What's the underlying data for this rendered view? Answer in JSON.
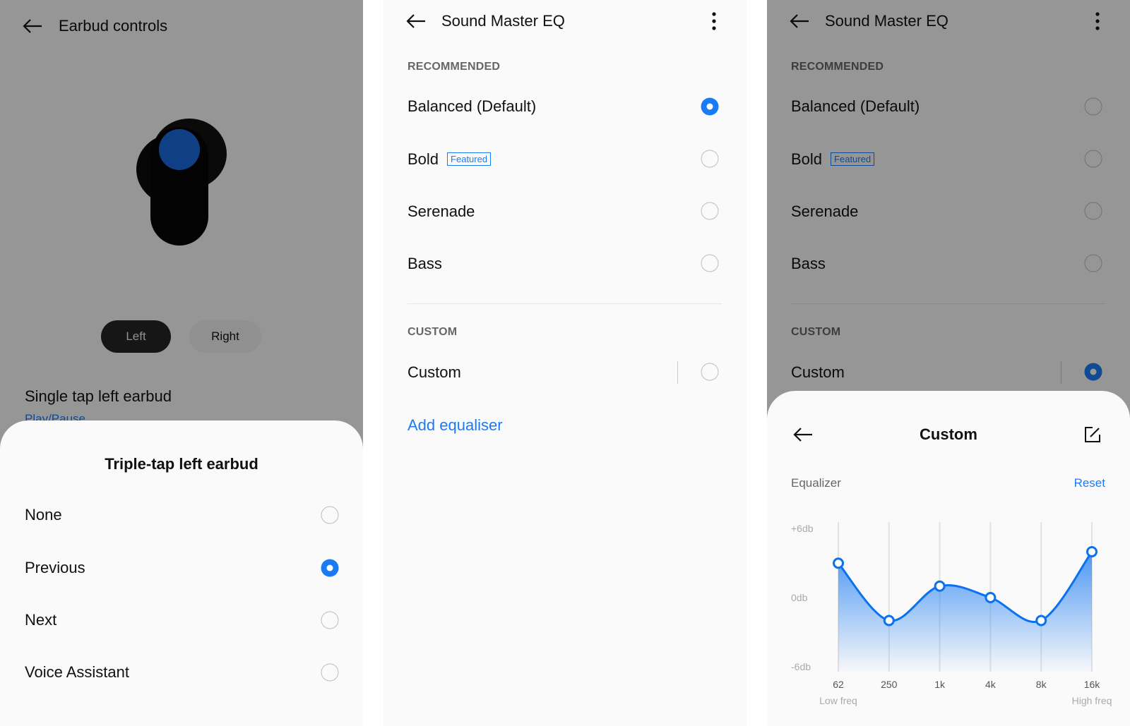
{
  "earbud_controls": {
    "title": "Earbud controls",
    "tabs": [
      {
        "label": "Left",
        "selected": true
      },
      {
        "label": "Right",
        "selected": false
      }
    ],
    "setting_label": "Single tap left earbud",
    "setting_value": "Play/Pause",
    "sheet": {
      "title": "Triple-tap left earbud",
      "options": [
        {
          "label": "None",
          "selected": false
        },
        {
          "label": "Previous",
          "selected": true
        },
        {
          "label": "Next",
          "selected": false
        },
        {
          "label": "Voice Assistant",
          "selected": false
        }
      ]
    }
  },
  "eq_list": {
    "title": "Sound Master EQ",
    "recommended_header": "RECOMMENDED",
    "presets": [
      {
        "label": "Balanced (Default)",
        "selected": true
      },
      {
        "label": "Bold",
        "badge": "Featured",
        "selected": false
      },
      {
        "label": "Serenade",
        "selected": false
      },
      {
        "label": "Bass",
        "selected": false
      }
    ],
    "custom_header": "CUSTOM",
    "custom": {
      "label": "Custom",
      "selected": false
    },
    "add_label": "Add equaliser"
  },
  "eq_custom": {
    "title": "Sound Master EQ",
    "recommended_header": "RECOMMENDED",
    "presets": [
      {
        "label": "Balanced (Default)",
        "selected": false
      },
      {
        "label": "Bold",
        "badge": "Featured",
        "selected": false
      },
      {
        "label": "Serenade",
        "selected": false
      },
      {
        "label": "Bass",
        "selected": false
      }
    ],
    "custom_header": "CUSTOM",
    "custom": {
      "label": "Custom",
      "selected": true
    },
    "sheet": {
      "title": "Custom",
      "section_label": "Equalizer",
      "reset_label": "Reset"
    }
  },
  "colors": {
    "accent": "#1a7cf5",
    "dim_overlay": "rgba(0,0,0,0.4)"
  },
  "chart_data": {
    "type": "area",
    "categories": [
      "62",
      "250",
      "1k",
      "4k",
      "8k",
      "16k"
    ],
    "values": [
      3,
      -2,
      1,
      0,
      -2,
      4
    ],
    "y_ticks": [
      "+6db",
      "0db",
      "-6db"
    ],
    "ylim": [
      -6,
      6
    ],
    "x_low_label": "Low freq",
    "x_high_label": "High freq",
    "grid": "vertical"
  }
}
